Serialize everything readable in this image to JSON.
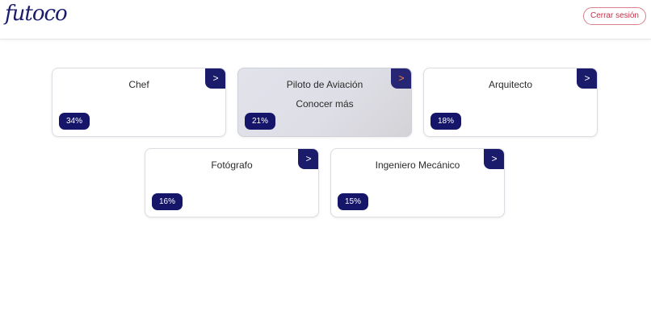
{
  "header": {
    "logo_text": "futoco",
    "logout_label": "Cerrar sesión"
  },
  "careers": [
    {
      "title": "Chef",
      "percent": "34%",
      "arrow": ">"
    },
    {
      "title": "Piloto de Aviación",
      "percent": "21%",
      "arrow": ">",
      "hover_label": "Conocer más"
    },
    {
      "title": "Arquitecto",
      "percent": "18%",
      "arrow": ">"
    },
    {
      "title": "Fotógrafo",
      "percent": "16%",
      "arrow": ">"
    },
    {
      "title": "Ingeniero Mecánico",
      "percent": "15%",
      "arrow": ">"
    }
  ],
  "colors": {
    "primary": "#1b1b6b",
    "logout_accent": "#c2334a",
    "hover_arrow_text": "#ff8a3d"
  }
}
